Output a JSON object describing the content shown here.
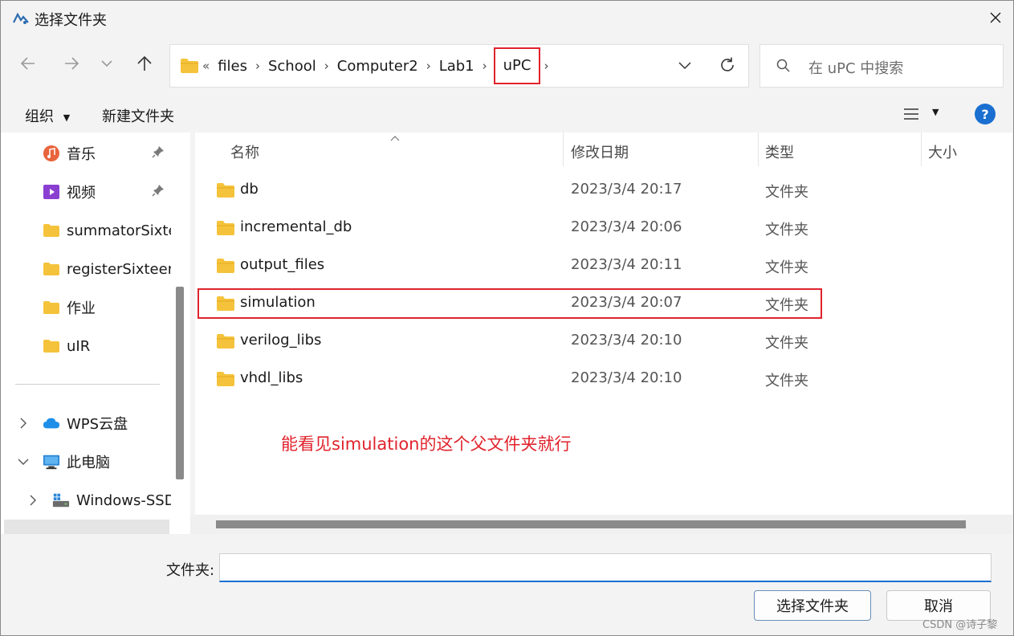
{
  "window": {
    "title": "选择文件夹"
  },
  "address": {
    "overflow": "«",
    "crumbs": [
      "files",
      "School",
      "Computer2",
      "Lab1",
      "uPC"
    ]
  },
  "search": {
    "placeholder": "在 uPC 中搜索"
  },
  "toolbar": {
    "organize": "组织",
    "new_folder": "新建文件夹",
    "help": "?"
  },
  "sidebar": {
    "items": [
      {
        "label": "音乐",
        "icon": "music-icon",
        "pinned": true
      },
      {
        "label": "视频",
        "icon": "video-icon",
        "pinned": true
      },
      {
        "label": "summatorSixteen",
        "icon": "folder-icon"
      },
      {
        "label": "registerSixteen",
        "icon": "folder-icon"
      },
      {
        "label": "作业",
        "icon": "folder-icon"
      },
      {
        "label": "uIR",
        "icon": "folder-icon"
      },
      {
        "label": "WPS云盘",
        "icon": "cloud-icon"
      },
      {
        "label": "此电脑",
        "icon": "computer-icon"
      },
      {
        "label": "Windows-SSD",
        "icon": "drive-icon"
      }
    ]
  },
  "columns": {
    "name": "名称",
    "modified": "修改日期",
    "type": "类型",
    "size": "大小"
  },
  "files": [
    {
      "name": "db",
      "modified": "2023/3/4 20:17",
      "type": "文件夹"
    },
    {
      "name": "incremental_db",
      "modified": "2023/3/4 20:06",
      "type": "文件夹"
    },
    {
      "name": "output_files",
      "modified": "2023/3/4 20:11",
      "type": "文件夹"
    },
    {
      "name": "simulation",
      "modified": "2023/3/4 20:07",
      "type": "文件夹"
    },
    {
      "name": "verilog_libs",
      "modified": "2023/3/4 20:10",
      "type": "文件夹"
    },
    {
      "name": "vhdl_libs",
      "modified": "2023/3/4 20:10",
      "type": "文件夹"
    }
  ],
  "annotation": "能看见simulation的这个父文件夹就行",
  "bottom": {
    "folder_label": "文件夹:",
    "folder_value": "",
    "select_button": "选择文件夹",
    "cancel_button": "取消"
  },
  "watermark": "CSDN @诗子黎",
  "colors": {
    "accent": "#1a6fd0",
    "highlight": "#e0232c",
    "folder": "#f5c33b"
  }
}
